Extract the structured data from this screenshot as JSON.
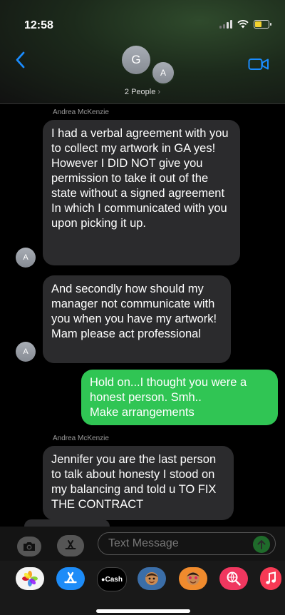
{
  "status_bar": {
    "time": "12:58"
  },
  "header": {
    "avatar_primary": "G",
    "avatar_secondary": "A",
    "people_label": "2 People",
    "people_chevron": "›"
  },
  "messages": [
    {
      "sender": "Andrea McKenzie",
      "direction": "incoming",
      "avatar": "A",
      "text": "I had a verbal agreement with you to collect my artwork in GA yes!\nHowever I DID NOT give you permission to take it out of the state without a signed agreement\nIn which I communicated with you upon picking it up."
    },
    {
      "sender": "",
      "direction": "incoming",
      "avatar": "A",
      "text": "And secondly how should my manager not communicate with you when you have my artwork!\nMam please act professional"
    },
    {
      "sender": "",
      "direction": "outgoing",
      "avatar": "",
      "text": "Hold on...I thought you were a honest person. Smh..\nMake arrangements"
    },
    {
      "sender": "Andrea McKenzie",
      "direction": "incoming",
      "avatar": "",
      "text": "Jennifer you are the last person to talk about honesty I stood on my balancing and told u TO FIX THE CONTRACT"
    }
  ],
  "composer": {
    "placeholder": "Text Message"
  },
  "app_tray": {
    "apple_cash_label": "Cash"
  }
}
